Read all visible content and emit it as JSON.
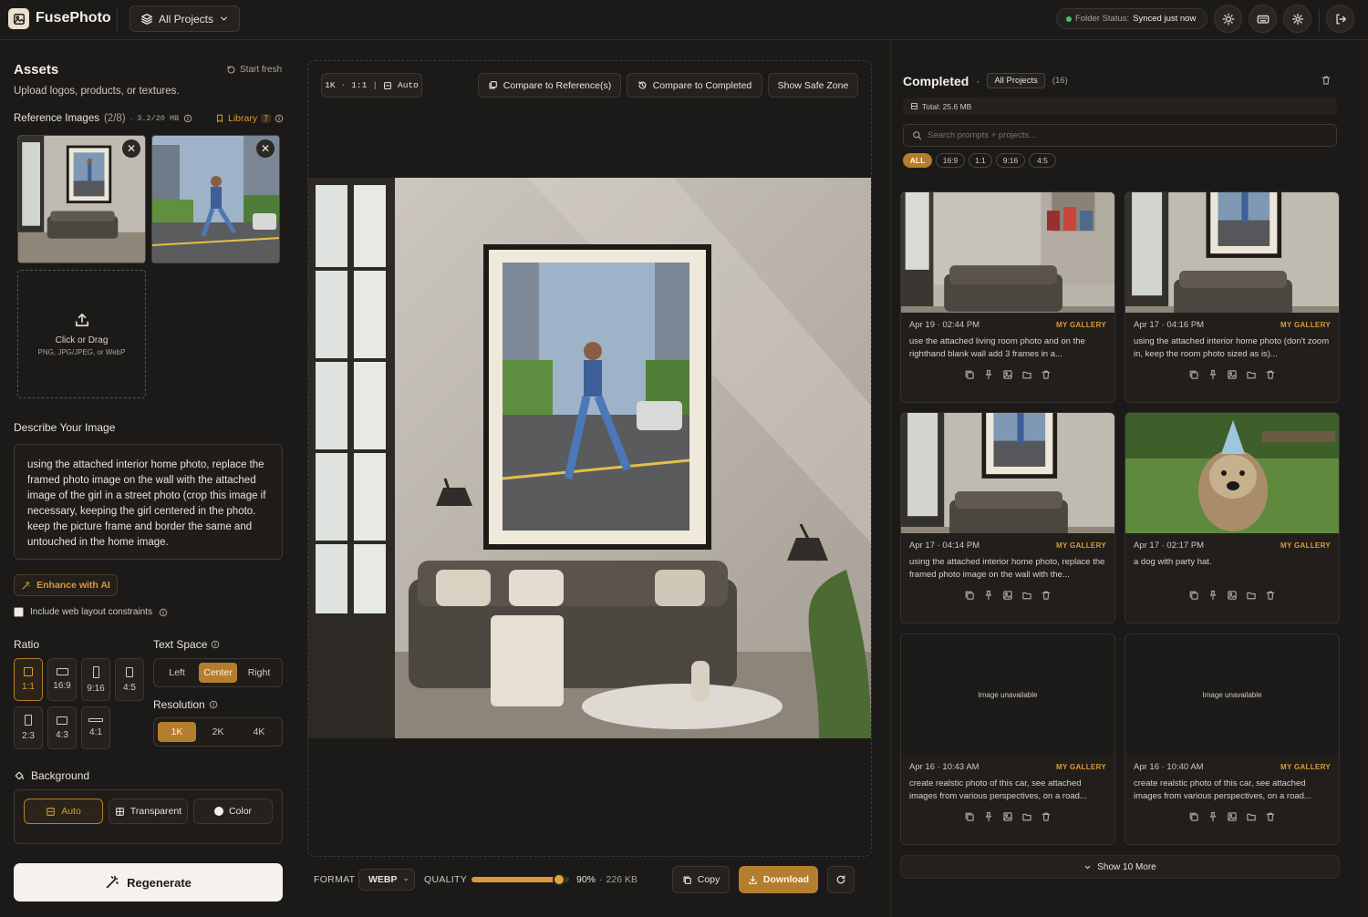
{
  "app": {
    "name": "FusePhoto",
    "project_selector": "All Projects"
  },
  "header": {
    "folder_status_label": "Folder Status:",
    "folder_status_value": "Synced just now"
  },
  "assets": {
    "title": "Assets",
    "start_fresh": "Start fresh",
    "subtitle": "Upload logos, products, or textures.",
    "reference_label": "Reference Images",
    "reference_count": "(2/8)",
    "reference_size": "3.2/20 MB",
    "library_label": "Library",
    "library_count": "7",
    "upload_title": "Click or Drag",
    "upload_formats": "PNG, JPG/JPEG, or WebP"
  },
  "describe": {
    "title": "Describe Your Image",
    "prompt": "using the attached interior home photo, replace the framed photo image on the wall with the attached image of the girl in a street photo (crop this image if necessary, keeping the girl centered in the photo. keep the picture frame and border the same and untouched in the home image.",
    "enhance_label": "Enhance with AI",
    "web_constraints_label": "Include web layout constraints"
  },
  "ratio": {
    "title": "Ratio",
    "options": [
      "1:1",
      "16:9",
      "9:16",
      "4:5",
      "2:3",
      "4:3",
      "4:1"
    ],
    "selected": "1:1"
  },
  "text_space": {
    "title": "Text Space",
    "options": [
      "Left",
      "Center",
      "Right"
    ],
    "selected": "Center"
  },
  "resolution": {
    "title": "Resolution",
    "options": [
      "1K",
      "2K",
      "4K"
    ],
    "selected": "1K"
  },
  "background": {
    "title": "Background",
    "options": [
      "Auto",
      "Transparent",
      "Color"
    ],
    "selected": "Auto"
  },
  "regenerate_label": "Regenerate",
  "canvas": {
    "info_res": "1K",
    "info_ratio": "1:1",
    "info_mode": "Auto",
    "compare_ref": "Compare to Reference(s)",
    "compare_completed": "Compare to Completed",
    "safe_zone": "Show Safe Zone"
  },
  "export": {
    "format_label": "FORMAT",
    "format_value": "WEBP",
    "quality_label": "QUALITY",
    "quality_percent": 90,
    "quality_text": "90%",
    "file_size": "226 KB",
    "copy_label": "Copy",
    "download_label": "Download"
  },
  "completed": {
    "title": "Completed",
    "scope": "All Projects",
    "count": "(16)",
    "total": "Total: 25.6 MB",
    "search_placeholder": "Search prompts + projects...",
    "filters": [
      "ALL",
      "16:9",
      "1:1",
      "9:16",
      "4:5"
    ],
    "active_filter": "ALL",
    "show_more": "Show 10 More",
    "unavailable_text": "Image unavailable",
    "items": [
      {
        "date": "Apr 19 · 02:44 PM",
        "tag": "MY GALLERY",
        "text": "use the attached living room photo and on the righthand blank wall add 3 frames in a..."
      },
      {
        "date": "Apr 17 · 04:16 PM",
        "tag": "MY GALLERY",
        "text": "using the attached interior home photo (don't zoom in, keep the room photo sized as is)..."
      },
      {
        "date": "Apr 17 · 04:14 PM",
        "tag": "MY GALLERY",
        "text": "using the attached interior home photo, replace the framed photo image on the wall with the..."
      },
      {
        "date": "Apr 17 · 02:17 PM",
        "tag": "MY GALLERY",
        "text": "a dog with party hat."
      },
      {
        "date": "Apr 16 · 10:43 AM",
        "tag": "MY GALLERY",
        "text": "create realstic photo of this car, see attached images from various perspectives, on a road..."
      },
      {
        "date": "Apr 16 · 10:40 AM",
        "tag": "MY GALLERY",
        "text": "create realstic photo of this car, see attached images from various perspectives, on a road..."
      }
    ]
  },
  "colors": {
    "accent": "#b57e2e",
    "accent_text": "#d99a3c",
    "background": "#1c1a18",
    "status_green": "#3ec46d"
  }
}
